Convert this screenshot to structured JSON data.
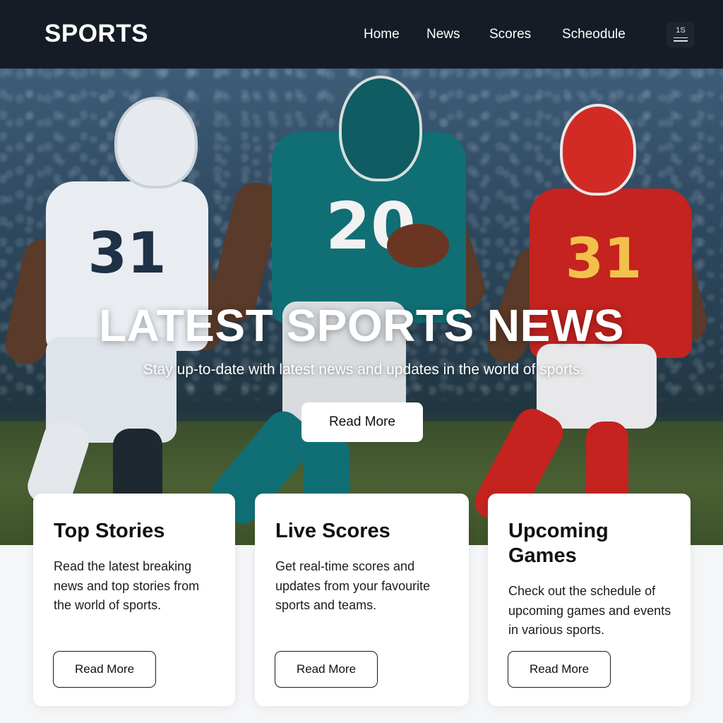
{
  "header": {
    "brand": "SPORTS",
    "nav": [
      "Home",
      "News",
      "Scores",
      "Scheodule"
    ],
    "menu_badge": "1S",
    "menu_icon": "hamburger-menu-icon"
  },
  "hero": {
    "title": "LATEST SPORTS NEWS",
    "subtitle": "Stay up-to-date with latest news and updates in the world of sports.",
    "button": "Read More",
    "players": [
      {
        "number": "31",
        "jersey_color": "#e9edf2",
        "number_color": "#1f3146"
      },
      {
        "number": "20",
        "jersey_color": "#0f6f74",
        "number_color": "#f2f2f2"
      },
      {
        "number": "31",
        "jersey_color": "#c4231f",
        "number_color": "#f2c14b"
      }
    ]
  },
  "cards": [
    {
      "title": "Top Stories",
      "text": "Read the latest breaking news and top stories from the world of sports.",
      "button": "Read More"
    },
    {
      "title": "Live Scores",
      "text": "Get real-time scores and updates from your favourite sports and teams.",
      "button": "Read More"
    },
    {
      "title": "Upcoming Games",
      "text": "Check out the schedule of upcoming games and events in various sports.",
      "button": "Read More"
    }
  ],
  "colors": {
    "nav_bg": "#161c26",
    "page_bg": "#f5f6f8",
    "card_bg": "#ffffff"
  }
}
